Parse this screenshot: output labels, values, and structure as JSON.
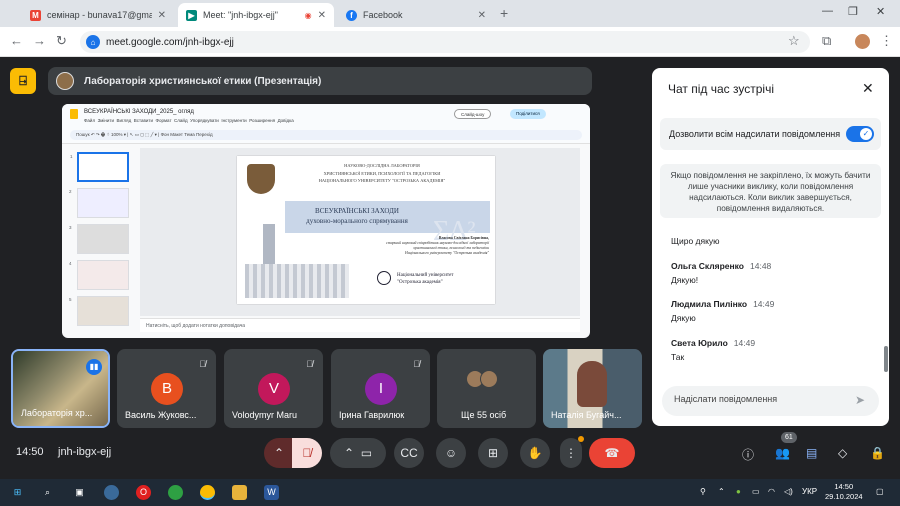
{
  "browser": {
    "tabs": [
      {
        "title": "семінар - bunava17@gmail.com",
        "icon": "gmail-icon",
        "active": false
      },
      {
        "title": "Meet: \"jnh-ibgx-ejj\"",
        "icon": "meet-icon",
        "active": true
      },
      {
        "title": "Facebook",
        "icon": "facebook-icon",
        "active": false
      }
    ],
    "url": "meet.google.com/jnh-ibgx-ejj"
  },
  "meeting": {
    "logo_glyph": "⍈",
    "presentation_title": "Лабораторія християнської етики (Презентація)",
    "time": "14:50",
    "code": "jnh-ibgx-ejj",
    "participants_count": "61"
  },
  "slides_doc": {
    "title": "ВСЕУКРАЇНСЬКІ ЗАХОДИ_2025_ огляд",
    "menu": [
      "Файл",
      "Змінити",
      "Вигляд",
      "Вставити",
      "Формат",
      "Слайд",
      "Упорядкувати",
      "Інструменти",
      "Розширення",
      "Довідка"
    ],
    "tools": "Пошук  ↶ ↷ 🖶  ⌖  100%  ▾  |  ↖  ▭  ◻  ⬚  ╱  ▾  |  Фон  Макет  Тема  Перехід",
    "slideshow_btn": "Слайд-шоу",
    "share_btn": "Поділитися",
    "notes_placeholder": "Натисніть, щоб додати нотатки доповідача"
  },
  "slide": {
    "header_lines": [
      "НАУКОВО-ДОСЛІДНА ЛАБОРАТОРІЯ",
      "ХРИСТИЯНСЬКОЇ ЕТИКИ, ПСИХОЛОГІЇ ТА ПЕДАГОГІКИ",
      "НАЦІОНАЛЬНОГО УНІВЕРСИТЕТУ \"ОСТРОЗЬКА АКАДЕМІЯ\""
    ],
    "title_line1": "ВСЕУКРАЇНСЬКІ ЗАХОДИ",
    "title_line2": "духовно-морального спрямування",
    "author_lines": [
      "Власова Світлана Борисівна,",
      "старший науковий співробітник науково-дослідної лабораторії",
      "християнської етики, психології та педагогіки",
      "Національного університету \"Острозька академія\""
    ],
    "university_lines": [
      "Національний університет",
      "\"Острозька академія\""
    ],
    "formula_text": "ΣΔ²"
  },
  "chat": {
    "heading": "Чат під час зустрічі",
    "allow_label": "Дозволити всім надсилати повідомлення",
    "notice": "Якщо повідомлення не закріплено, їх можуть бачити лише учасники виклику, коли повідомлення надсилаються. Коли виклик завершується, повідомлення видаляються.",
    "messages": [
      {
        "name": "",
        "time": "",
        "text": "Щиро дякую"
      },
      {
        "name": "Ольга Скляренко",
        "time": "14:48",
        "text": "Дякую!"
      },
      {
        "name": "Людмила Пилінко",
        "time": "14:49",
        "text": "Дякую"
      },
      {
        "name": "Света Юрило",
        "time": "14:49",
        "text": "Так"
      }
    ],
    "input_placeholder": "Надіслати повідомлення"
  },
  "tiles": [
    {
      "name": "Лабораторія хр...",
      "type": "self"
    },
    {
      "name": "Василь Жуковс...",
      "letter": "В",
      "color": "#e8501f"
    },
    {
      "name": "Volodymyr Maru",
      "letter": "V",
      "color": "#c2185b"
    },
    {
      "name": "Ірина Гаврилюк",
      "letter": "І",
      "color": "#8e24aa"
    },
    {
      "name": "Ще 55 осіб",
      "type": "more"
    },
    {
      "name": "Наталія Бугайч...",
      "type": "camera"
    }
  ],
  "taskbar": {
    "time": "14:50",
    "date": "29.10.2024",
    "lang": "УКР"
  },
  "colors": {
    "meet_bg": "#202124",
    "accent_blue": "#1a73e8",
    "end_call_red": "#ea4335"
  }
}
